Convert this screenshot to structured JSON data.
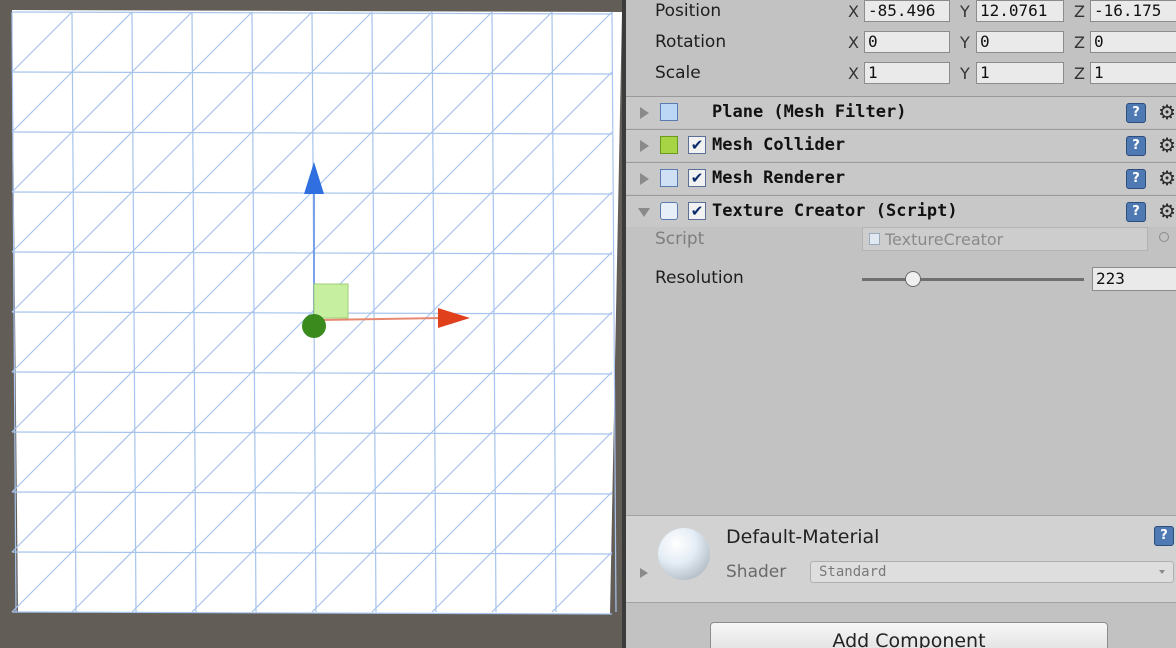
{
  "transform": {
    "position": {
      "label": "Position",
      "x": "-85.496",
      "y": "12.0761",
      "z": "-16.175"
    },
    "rotation": {
      "label": "Rotation",
      "x": "0",
      "y": "0",
      "z": "0"
    },
    "scale": {
      "label": "Scale",
      "x": "1",
      "y": "1",
      "z": "1"
    },
    "axis_labels": {
      "x": "X",
      "y": "Y",
      "z": "Z"
    }
  },
  "components": [
    {
      "name": "Plane (Mesh Filter)",
      "icon": "mesh-filter-icon",
      "has_checkbox": false,
      "expanded": false
    },
    {
      "name": "Mesh Collider",
      "icon": "mesh-collider-icon",
      "has_checkbox": true,
      "enabled": true,
      "expanded": false
    },
    {
      "name": "Mesh Renderer",
      "icon": "mesh-renderer-icon",
      "has_checkbox": true,
      "enabled": true,
      "expanded": false
    },
    {
      "name": "Texture Creator (Script)",
      "icon": "script-icon",
      "has_checkbox": true,
      "enabled": true,
      "expanded": true
    }
  ],
  "component_help_glyph": "?",
  "component_menu_glyph": "⚙",
  "checkbox_glyph": "✔",
  "script_component": {
    "script_label": "Script",
    "script_value": "TextureCreator",
    "resolution_label": "Resolution",
    "resolution_value": "223",
    "resolution_slider_fraction": 0.23
  },
  "material": {
    "name": "Default-Material",
    "shader_label": "Shader",
    "shader_value": "Standard"
  },
  "add_component_label": "Add Component",
  "colors": {
    "inspector_bg": "#c2c2c2",
    "grid_line": "#a7c4ec",
    "y_axis": "#2f6fe0",
    "x_axis": "#e0401c",
    "center_handle": "#3a8a1e",
    "plane_handle": "#c6f0a0"
  }
}
